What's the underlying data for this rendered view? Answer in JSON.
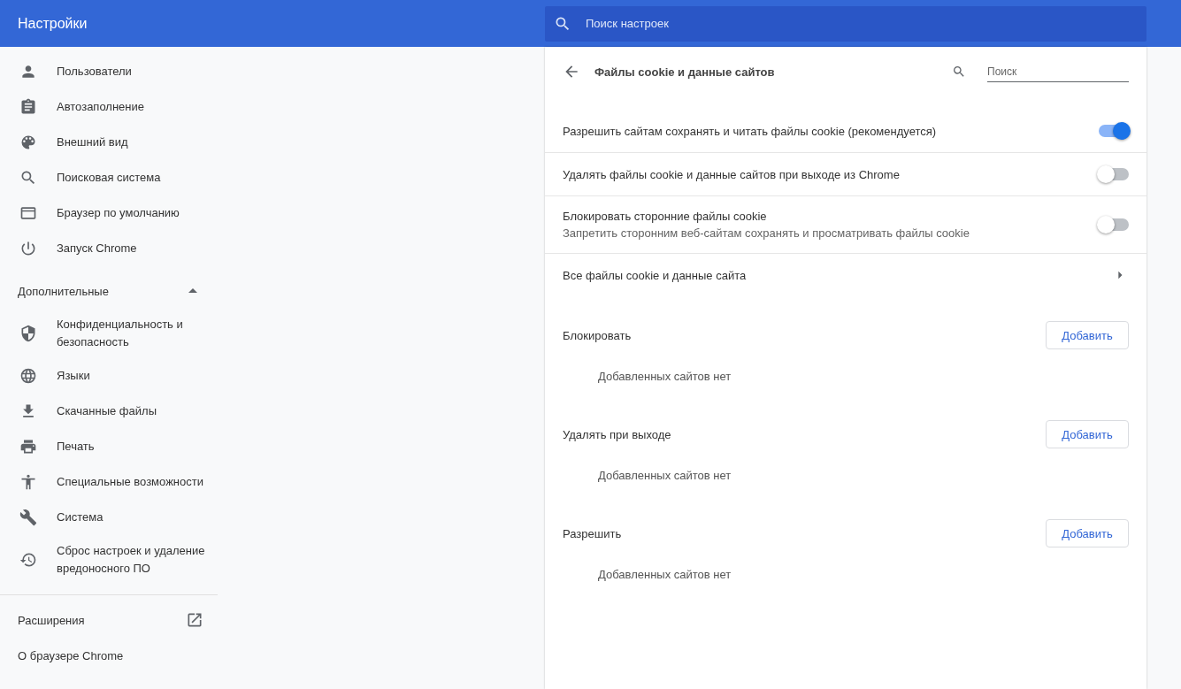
{
  "header": {
    "title": "Настройки",
    "search": {
      "placeholder": "Поиск настроек"
    }
  },
  "sidebar": {
    "items": [
      {
        "label": "Пользователи"
      },
      {
        "label": "Автозаполнение"
      },
      {
        "label": "Внешний вид"
      },
      {
        "label": "Поисковая система"
      },
      {
        "label": "Браузер по умолчанию"
      },
      {
        "label": "Запуск Chrome"
      }
    ],
    "advanced": {
      "label": "Дополнительные",
      "expanded": true
    },
    "advanced_items": [
      {
        "label": "Конфиденциальность и безопасность"
      },
      {
        "label": "Языки"
      },
      {
        "label": "Скачанные файлы"
      },
      {
        "label": "Печать"
      },
      {
        "label": "Специальные возможности"
      },
      {
        "label": "Система"
      },
      {
        "label": "Сброс настроек и удаление вредоносного ПО"
      }
    ],
    "footer": [
      {
        "label": "Расширения",
        "kind": "external"
      },
      {
        "label": "О браузере Chrome",
        "kind": "plain"
      }
    ]
  },
  "page": {
    "title": "Файлы cookie и данные сайтов",
    "search": {
      "placeholder": "Поиск"
    },
    "settings": [
      {
        "kind": "toggle",
        "label": "Разрешить сайтам сохранять и читать файлы cookie (рекомендуется)",
        "on": true
      },
      {
        "kind": "toggle",
        "label": "Удалять файлы cookie и данные сайтов при выходе из Chrome",
        "on": false
      },
      {
        "kind": "toggle",
        "label": "Блокировать сторонние файлы cookie",
        "sublabel": "Запретить сторонним веб-сайтам сохранять и просматривать файлы cookie",
        "on": false
      },
      {
        "kind": "link",
        "label": "Все файлы cookie и данные сайта"
      }
    ],
    "sections": [
      {
        "title": "Блокировать",
        "button": "Добавить",
        "empty": "Добавленных сайтов нет"
      },
      {
        "title": "Удалять при выходе",
        "button": "Добавить",
        "empty": "Добавленных сайтов нет"
      },
      {
        "title": "Разрешить",
        "button": "Добавить",
        "empty": "Добавленных сайтов нет"
      }
    ]
  }
}
